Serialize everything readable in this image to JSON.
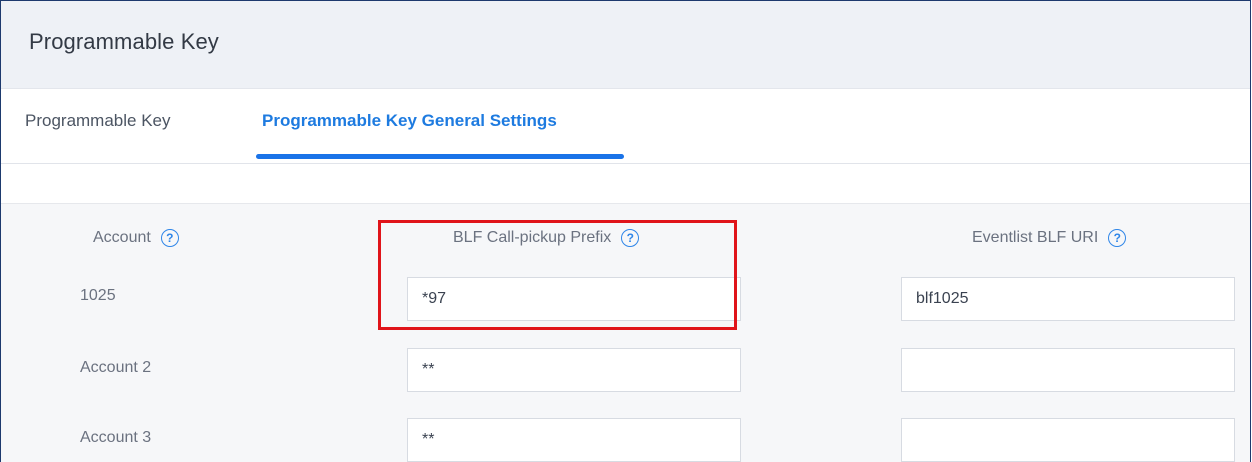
{
  "header": {
    "title": "Programmable Key"
  },
  "tabs": [
    {
      "label": "Programmable Key",
      "active": false
    },
    {
      "label": "Programmable Key General Settings",
      "active": true
    }
  ],
  "columns": {
    "account": {
      "label": "Account",
      "icon": "help-circle-icon"
    },
    "blf_prefix": {
      "label": "BLF Call-pickup Prefix",
      "icon": "help-circle-icon"
    },
    "eventlist_uri": {
      "label": "Eventlist BLF URI",
      "icon": "help-circle-icon"
    }
  },
  "help_glyph": "?",
  "rows": [
    {
      "account": "1025",
      "blf_prefix": "*97",
      "eventlist_uri": "blf1025"
    },
    {
      "account": "Account 2",
      "blf_prefix": "**",
      "eventlist_uri": ""
    },
    {
      "account": "Account 3",
      "blf_prefix": "**",
      "eventlist_uri": ""
    }
  ],
  "colors": {
    "accent": "#1a73e8",
    "highlight": "#e0141a"
  }
}
